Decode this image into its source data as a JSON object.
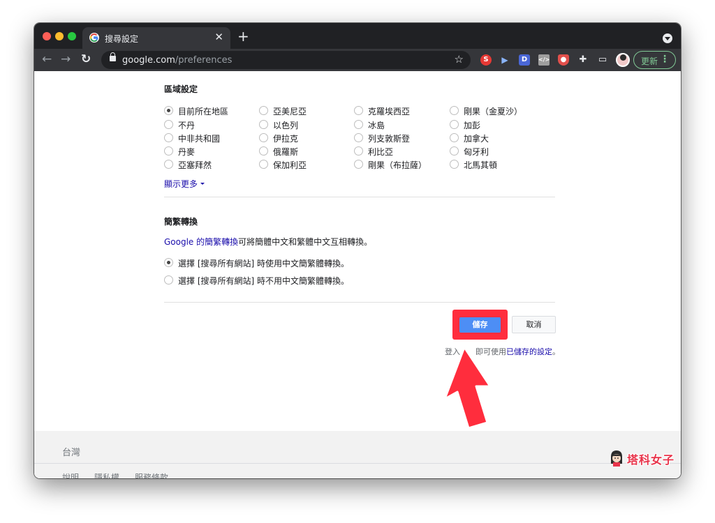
{
  "browser": {
    "tab_title": "搜尋設定",
    "url_host": "google.com",
    "url_path": "/preferences",
    "update_label": "更新",
    "extensions": [
      {
        "name": "S",
        "color": "#e53935"
      },
      {
        "name": "D",
        "color": "#4a67d6"
      }
    ]
  },
  "region": {
    "title": "區域設定",
    "items": [
      "目前所在地區",
      "不丹",
      "中非共和國",
      "丹麥",
      "亞塞拜然",
      "亞美尼亞",
      "以色列",
      "伊拉克",
      "俄羅斯",
      "保加利亞",
      "克羅埃西亞",
      "冰島",
      "列支敦斯登",
      "利比亞",
      "剛果（布拉薩）",
      "剛果（金夏沙）",
      "加彭",
      "加拿大",
      "匈牙利",
      "北馬其頓"
    ],
    "show_more": "顯示更多"
  },
  "conversion": {
    "title": "簡繁轉換",
    "desc_link": "Google 的簡繁轉換",
    "desc_rest": "可將簡體中文和繁體中文互相轉換。",
    "option_on": "選擇 [搜尋所有網站] 時使用中文簡繁體轉換。",
    "option_off": "選擇 [搜尋所有網站] 時不用中文簡繁體轉換。"
  },
  "actions": {
    "save": "儲存",
    "cancel": "取消",
    "note_part1": "登入",
    "note_part2": "即可使用",
    "note_link": "已儲存的設定",
    "note_part3": "。"
  },
  "footer": {
    "country": "台灣",
    "links": [
      "說明",
      "隱私權",
      "服務條款"
    ]
  },
  "watermark": {
    "text": "塔科女子"
  },
  "colors": {
    "accent_blue": "#4d8ef5",
    "highlight_red": "#ff2d3d",
    "link_blue": "#1a0dab"
  }
}
